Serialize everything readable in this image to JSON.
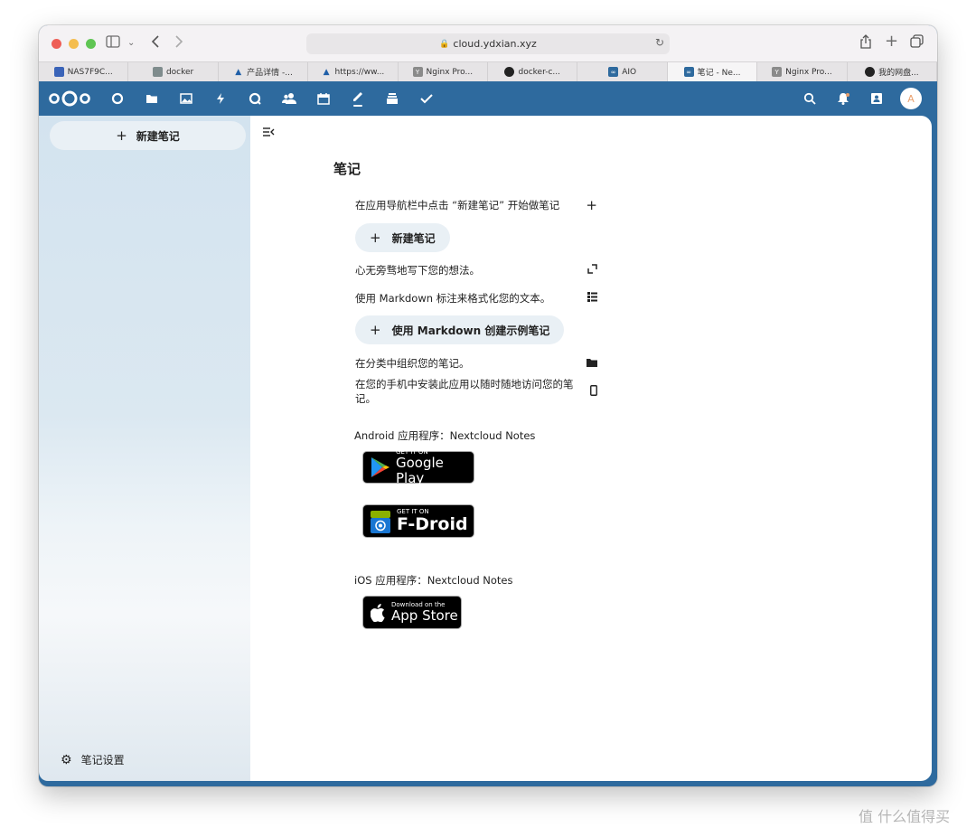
{
  "browser": {
    "url": "cloud.ydxian.xyz",
    "tabs": [
      {
        "label": "NAS7F9C...",
        "color": "#3a63b8"
      },
      {
        "label": "docker",
        "color": "#7f8c8d"
      },
      {
        "label": "产品详情 -...",
        "color": "#1f5fa8"
      },
      {
        "label": "https://ww...",
        "color": "#1f5fa8"
      },
      {
        "label": "Nginx Pro...",
        "color": "#8a8a8a"
      },
      {
        "label": "docker-c...",
        "color": "#222222"
      },
      {
        "label": "AIO",
        "color": "#2e6a9e"
      },
      {
        "label": "笔记 - Ne...",
        "color": "#2e6a9e"
      },
      {
        "label": "Nginx Pro...",
        "color": "#8a8a8a"
      },
      {
        "label": "我的网盘...",
        "color": "#222222"
      }
    ]
  },
  "header": {
    "apps": [
      "dashboard-icon",
      "files-icon",
      "photos-icon",
      "activity-icon",
      "talk-icon",
      "contacts-icon",
      "calendar-icon",
      "notes-icon",
      "deck-icon",
      "tasks-icon"
    ],
    "avatar_letter": "A",
    "brand_color": "#2e6a9e"
  },
  "sidebar": {
    "new_note": "新建笔记",
    "settings": "笔记设置"
  },
  "main": {
    "title": "笔记",
    "hint_nav": "在应用导航栏中点击 “新建笔记” 开始做笔记",
    "new_note_button": "新建笔记",
    "hint_write": "心无旁骛地写下您的想法。",
    "hint_markdown": "使用 Markdown 标注来格式化您的文本。",
    "markdown_button": "使用 Markdown 创建示例笔记",
    "hint_category": "在分类中组织您的笔记。",
    "hint_mobile": "在您的手机中安装此应用以随时随地访问您的笔记。",
    "android_label": "Android 应用程序：Nextcloud Notes",
    "google_play": {
      "small": "GET IT ON",
      "big": "Google Play"
    },
    "fdroid": {
      "small": "GET IT ON",
      "big": "F-Droid"
    },
    "ios_label": "iOS 应用程序：Nextcloud Notes",
    "app_store": {
      "small": "Download on the",
      "big": "App Store"
    }
  },
  "watermark": "值 什么值得买"
}
